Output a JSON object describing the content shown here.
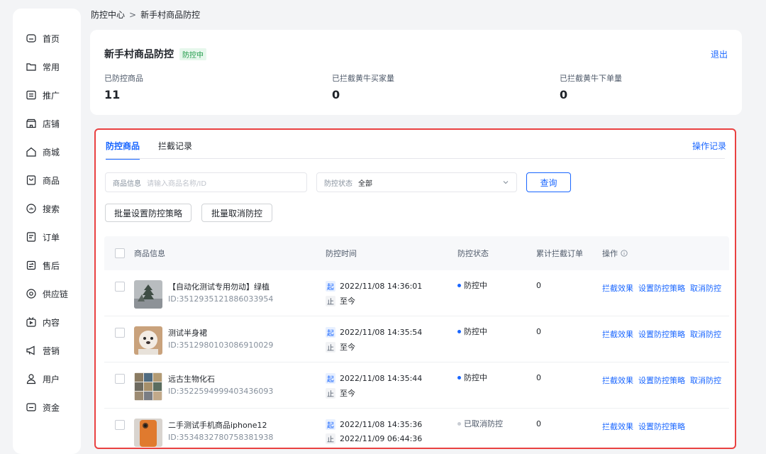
{
  "sidebar": {
    "items": [
      {
        "label": "首页",
        "icon": "home-icon"
      },
      {
        "label": "常用",
        "icon": "folder-icon"
      },
      {
        "label": "推广",
        "icon": "promotion-icon"
      },
      {
        "label": "店铺",
        "icon": "store-icon"
      },
      {
        "label": "商城",
        "icon": "mall-icon"
      },
      {
        "label": "商品",
        "icon": "product-icon"
      },
      {
        "label": "搜索",
        "icon": "search-icon"
      },
      {
        "label": "订单",
        "icon": "order-icon"
      },
      {
        "label": "售后",
        "icon": "after-sales-icon"
      },
      {
        "label": "供应链",
        "icon": "supply-chain-icon"
      },
      {
        "label": "内容",
        "icon": "content-icon"
      },
      {
        "label": "营销",
        "icon": "marketing-icon"
      },
      {
        "label": "用户",
        "icon": "user-icon"
      },
      {
        "label": "资金",
        "icon": "wallet-icon"
      }
    ]
  },
  "breadcrumb": {
    "parent": "防控中心",
    "separator": ">",
    "current": "新手村商品防控"
  },
  "summary": {
    "title": "新手村商品防控",
    "status": "防控中",
    "exit": "退出",
    "stats": [
      {
        "label": "已防控商品",
        "value": "11"
      },
      {
        "label": "已拦截黄牛买家量",
        "value": "0"
      },
      {
        "label": "已拦截黄牛下单量",
        "value": "0"
      }
    ]
  },
  "main": {
    "tabs": [
      {
        "label": "防控商品",
        "active": true
      },
      {
        "label": "拦截记录",
        "active": false
      }
    ],
    "op_record": "操作记录",
    "filters": {
      "product_label": "商品信息",
      "product_placeholder": "请输入商品名称/ID",
      "status_label": "防控状态",
      "status_value": "全部"
    },
    "query_button": "查询",
    "batch_set": "批量设置防控策略",
    "batch_cancel": "批量取消防控"
  },
  "table": {
    "headers": {
      "product": "商品信息",
      "time": "防控时间",
      "status": "防控状态",
      "count": "累计拦截订单",
      "action": "操作"
    },
    "rows": [
      {
        "name": "【自动化测试专用勿动】绿植",
        "id": "ID:3512935121886033954",
        "start_tag": "起",
        "start": "2022/11/08 14:36:01",
        "end_tag": "止",
        "end": "至今",
        "status": "防控中",
        "count": "0",
        "actions": [
          "拦截效果",
          "设置防控策略",
          "取消防控"
        ]
      },
      {
        "name": "测试半身裙",
        "id": "ID:3512980103086910029",
        "start_tag": "起",
        "start": "2022/11/08 14:35:54",
        "end_tag": "止",
        "end": "至今",
        "status": "防控中",
        "count": "0",
        "actions": [
          "拦截效果",
          "设置防控策略",
          "取消防控"
        ]
      },
      {
        "name": "远古生物化石",
        "id": "ID:3522594999403436093",
        "start_tag": "起",
        "start": "2022/11/08 14:35:44",
        "end_tag": "止",
        "end": "至今",
        "status": "防控中",
        "count": "0",
        "actions": [
          "拦截效果",
          "设置防控策略",
          "取消防控"
        ]
      },
      {
        "name": "二手测试手机商品iphone12",
        "id": "ID:3534832780758381938",
        "start_tag": "起",
        "start": "2022/11/08 14:35:36",
        "end_tag": "止",
        "end": "2022/11/09 06:44:36",
        "status": "已取消防控",
        "count": "0",
        "actions": [
          "拦截效果",
          "设置防控策略"
        ]
      }
    ]
  },
  "colors": {
    "accent": "#1966ff",
    "highlight_border": "#e94141",
    "status_active": "#1d9a47"
  }
}
